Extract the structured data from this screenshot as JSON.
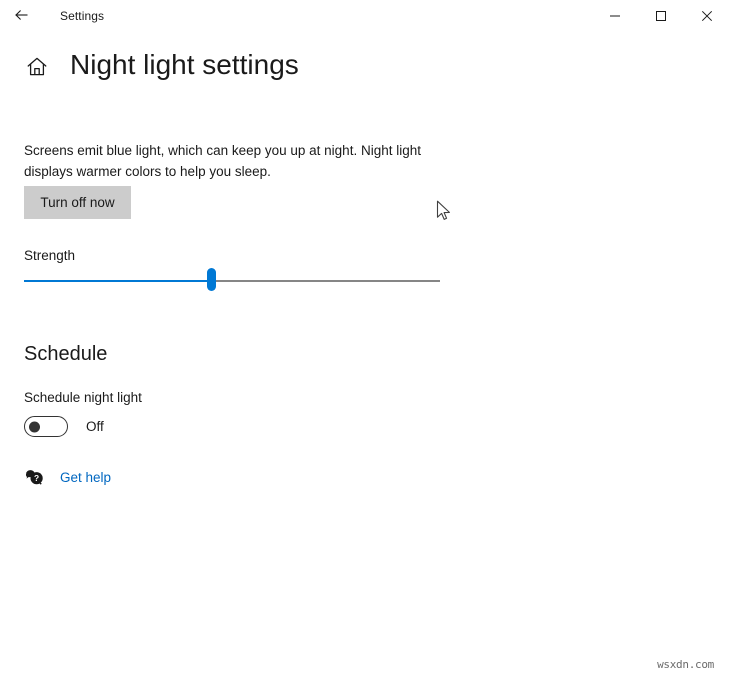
{
  "window": {
    "app_title": "Settings",
    "back_icon": "arrow-left-icon",
    "caption": {
      "minimize_icon": "minimize-icon",
      "maximize_icon": "maximize-icon",
      "close_icon": "close-icon"
    }
  },
  "header": {
    "home_icon": "home-icon",
    "title": "Night light settings"
  },
  "main": {
    "description": "Screens emit blue light, which can keep you up at night. Night light displays warmer colors to help you sleep.",
    "turn_off_label": "Turn off now",
    "strength": {
      "label": "Strength",
      "value_percent": 45
    },
    "schedule": {
      "section_title": "Schedule",
      "toggle_label": "Schedule night light",
      "toggle_state": "Off",
      "toggle_on": false
    },
    "help": {
      "icon": "question-bubble-icon",
      "label": "Get help"
    }
  },
  "colors": {
    "accent": "#0078d4",
    "link": "#0067c0",
    "button_face": "#cccccc",
    "track": "#868686",
    "text": "#1a1a1a"
  },
  "watermark": "wsxdn.com"
}
